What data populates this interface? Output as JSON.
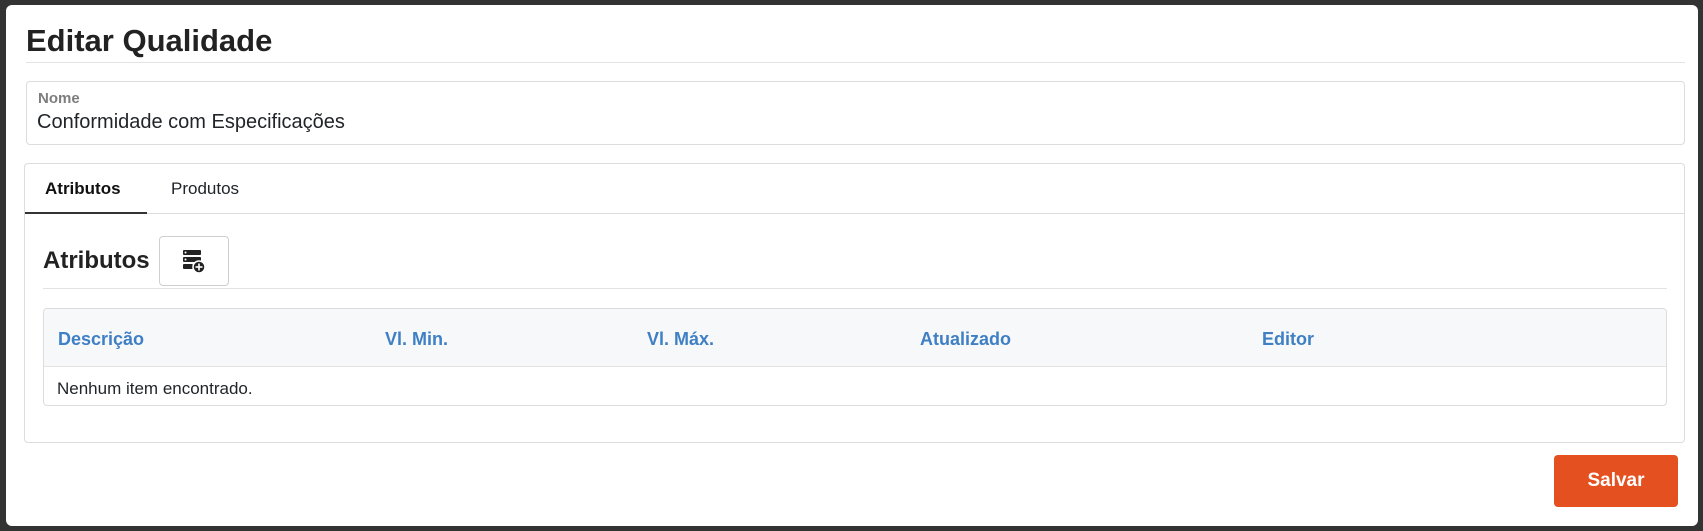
{
  "page": {
    "title": "Editar Qualidade"
  },
  "form": {
    "name_label": "Nome",
    "name_value": "Conformidade com Especificações"
  },
  "tabs": [
    {
      "label": "Atributos",
      "active": true
    },
    {
      "label": "Produtos",
      "active": false
    }
  ],
  "attributes_section": {
    "title": "Atributos",
    "add_button_icon": "database-add-icon",
    "table": {
      "columns": [
        "Descrição",
        "Vl. Min.",
        "Vl. Máx.",
        "Atualizado",
        "Editor"
      ],
      "empty_message": "Nenhum item encontrado."
    }
  },
  "actions": {
    "save_label": "Salvar"
  },
  "colors": {
    "accent": "#e4501f",
    "header_link": "#3f7fc4",
    "label_gray": "#7d7d7d",
    "table_header_bg": "#f7f8fa"
  }
}
